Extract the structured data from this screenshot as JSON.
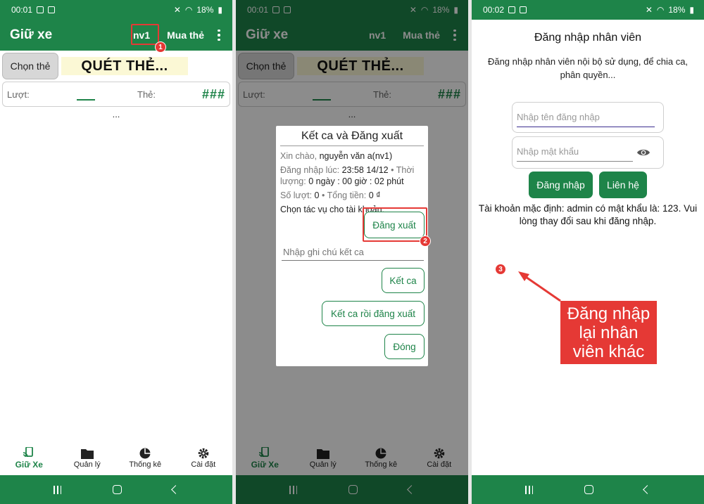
{
  "screens": [
    {
      "status": {
        "time": "00:01",
        "battery": "18%"
      },
      "app_title": "Giữ xe",
      "actions": {
        "user": "nv1",
        "buy_card": "Mua thẻ"
      },
      "choose_card": "Chọn thẻ",
      "scan_text": "QUÉT THẺ...",
      "card_row": {
        "luot_label": "Lượt:",
        "the_label": "Thẻ:",
        "hash": "###"
      },
      "ellipsis": "...",
      "bottom_nav": [
        {
          "label": "Giữ Xe",
          "icon": "phone-cast-icon"
        },
        {
          "label": "Quản lý",
          "icon": "folder-icon"
        },
        {
          "label": "Thống kê",
          "icon": "pie-chart-icon"
        },
        {
          "label": "Cài đặt",
          "icon": "gear-icon"
        }
      ]
    },
    {
      "status": {
        "time": "00:01",
        "battery": "18%"
      },
      "dialog": {
        "title": "Kết ca và Đăng xuất",
        "greeting_label": "Xin chào,",
        "greeting_name": "nguyễn văn a(nv1)",
        "login_label": "Đăng nhập lúc:",
        "login_time": "23:58 14/12",
        "duration_label": "• Thời lượng:",
        "duration_value": "0 ngày : 00 giờ : 02 phút",
        "count_label": "Số lượt:",
        "count_value": "0",
        "total_label": "• Tổng tiền:",
        "total_value": "0 ₫",
        "choose_task": "Chọn tác vụ cho tài khoản:",
        "logout": "Đăng xuất",
        "note_placeholder": "Nhập ghi chú kết ca",
        "end_shift": "Kết ca",
        "end_shift_logout": "Kết ca rồi đăng xuất",
        "close": "Đóng"
      }
    },
    {
      "status": {
        "time": "00:02",
        "battery": "18%"
      },
      "title": "Đăng nhập nhân viên",
      "description": "Đăng nhập nhân viên nội bộ sử dụng, để chia ca, phân quyền...",
      "username_placeholder": "Nhập tên đăng nhập",
      "password_placeholder": "Nhập mật khẩu",
      "login_button": "Đăng nhập",
      "contact_button": "Liên hệ",
      "note": "Tài khoản mặc định: admin có mật khẩu là: 123. Vui lòng thay đổi sau khi đăng nhập."
    }
  ],
  "annotations": {
    "badge1": "1",
    "badge2": "2",
    "badge3": "3",
    "callout": "Đăng nhập lại nhân viên khác",
    "colors": {
      "primary": "#1e8449",
      "annotation": "#e53935"
    }
  }
}
